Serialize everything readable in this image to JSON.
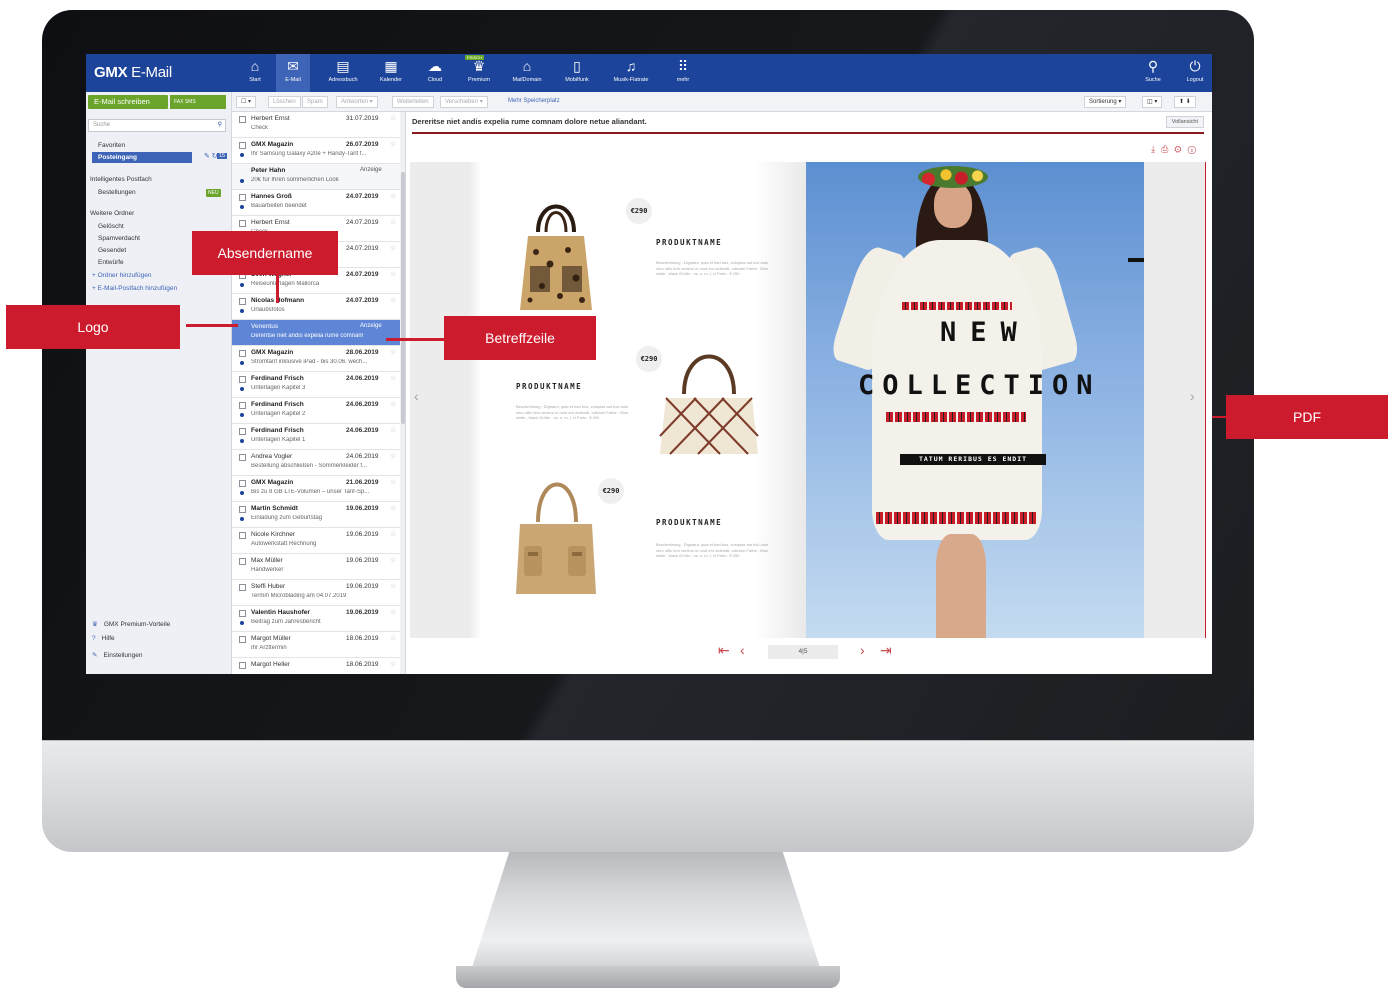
{
  "app": {
    "logo_bold": "GMX",
    "logo_rest": " E-Mail"
  },
  "nav": [
    {
      "label": "Start",
      "icon": "home-icon",
      "glyph": "⌂"
    },
    {
      "label": "E-Mail",
      "icon": "envelope-icon",
      "glyph": "✉"
    },
    {
      "label": "Adressbuch",
      "icon": "address-book-icon",
      "glyph": "▤"
    },
    {
      "label": "Kalender",
      "icon": "calendar-icon",
      "glyph": "▦"
    },
    {
      "label": "Cloud",
      "icon": "cloud-icon",
      "glyph": "☁"
    },
    {
      "label": "Premium",
      "icon": "premium-crown-icon",
      "glyph": "♛",
      "badge": "FRISCH"
    },
    {
      "label": "MailDomain",
      "icon": "domain-house-icon",
      "glyph": "⌂"
    },
    {
      "label": "Mobilfunk",
      "icon": "mobile-icon",
      "glyph": "▯"
    },
    {
      "label": "Musik-Flatrate",
      "icon": "music-icon",
      "glyph": "♫"
    },
    {
      "label": "mehr",
      "icon": "grid-icon",
      "glyph": "⠿"
    }
  ],
  "nav_right": [
    {
      "label": "Suche",
      "icon": "search-icon",
      "glyph": "⚲"
    },
    {
      "label": "Logout",
      "icon": "power-icon",
      "glyph": "⏻"
    }
  ],
  "sidebar": {
    "compose": "E-Mail schreiben",
    "fax_sms": "FAX SMS",
    "search_placeholder": "Suche",
    "favoriten": "Favoriten",
    "posteingang": "Posteingang",
    "posteingang_count": "15",
    "smart_box": "Intelligentes Postfach",
    "bestellungen": "Bestellungen",
    "neu_badge": "NEU",
    "weitere": "Weitere Ordner",
    "folders": [
      "Gelöscht",
      "Spamverdacht",
      "Gesendet",
      "Entwürfe"
    ],
    "add_folder": "Ordner hinzufügen",
    "add_mailbox": "E-Mail-Postfach hinzufügen",
    "bottom": [
      {
        "label": "GMX Premium-Vorteile",
        "icon": "crown-icon",
        "glyph": "♛"
      },
      {
        "label": "Hilfe",
        "icon": "help-icon",
        "glyph": "?"
      },
      {
        "label": "Einstellungen",
        "icon": "wrench-icon",
        "glyph": "✎"
      }
    ]
  },
  "toolbar": {
    "delete": "Löschen",
    "spam": "Spam",
    "reply": "Antworten",
    "forward": "Weiterleiten",
    "move": "Verschieben",
    "more_storage": "Mehr Speicherplatz",
    "sort": "Sortierung"
  },
  "messages": [
    {
      "sender": "Herbert Ernst",
      "date": "31.07.2019",
      "subject": "Check",
      "unread": false
    },
    {
      "sender": "GMX Magazin",
      "date": "26.07.2019",
      "subject": "Ihr Samsung Galaxy A20e + Handy-Tarif f...",
      "unread": true
    },
    {
      "sender": "Peter Hahn",
      "date": "Anzeige",
      "subject": "20€ für Ihren sommerlichen Look",
      "unread": true,
      "ad": true
    },
    {
      "sender": "Hannes Groß",
      "date": "24.07.2019",
      "subject": "Bauarbeiten beendet",
      "unread": true
    },
    {
      "sender": "Herbert Ernst",
      "date": "24.07.2019",
      "subject": "Check",
      "unread": false
    },
    {
      "sender": "Susanne Meyer",
      "date": "24.07.2019",
      "subject": "Urlaubsfotos",
      "unread": false
    },
    {
      "sender": "Sven Wagner",
      "date": "24.07.2019",
      "subject": "Reiseunterlagen Mallorca",
      "unread": true
    },
    {
      "sender": "Nicolas Hofmann",
      "date": "24.07.2019",
      "subject": "Urlaubsfotos",
      "unread": true
    },
    {
      "sender": "Venentus",
      "date": "Anzeige",
      "subject": "Dereritse niet andis expelia rume comnam",
      "unread": false,
      "ad": true,
      "selected": true
    },
    {
      "sender": "GMX Magazin",
      "date": "28.06.2019",
      "subject": "Stromtarif inklusive iPad - bis 30.06. wech...",
      "unread": true
    },
    {
      "sender": "Ferdinand Frisch",
      "date": "24.06.2019",
      "subject": "Unterlagen Kapitel 3",
      "unread": true
    },
    {
      "sender": "Ferdinand Frisch",
      "date": "24.06.2019",
      "subject": "Unterlagen Kapitel 2",
      "unread": true
    },
    {
      "sender": "Ferdinand Frisch",
      "date": "24.06.2019",
      "subject": "Unterlagen Kapitel 1",
      "unread": true
    },
    {
      "sender": "Andrea Vogler",
      "date": "24.06.2019",
      "subject": "Bestellung abschließen - Sommerkleider f...",
      "unread": false
    },
    {
      "sender": "GMX Magazin",
      "date": "21.06.2019",
      "subject": "Bis zu 8 GB LTE-Volumen – unser Tarif-Sp...",
      "unread": true
    },
    {
      "sender": "Martin Schmidt",
      "date": "19.06.2019",
      "subject": "Einladung zum Geburtstag",
      "unread": true
    },
    {
      "sender": "Nicole Kirchner",
      "date": "19.06.2019",
      "subject": "Autowerkstatt Rechnung",
      "unread": false
    },
    {
      "sender": "Max Müller",
      "date": "19.06.2019",
      "subject": "Handwerker",
      "unread": false
    },
    {
      "sender": "Steffi Huber",
      "date": "19.06.2019",
      "subject": "Termin Microblading am 04.07.2019",
      "unread": false
    },
    {
      "sender": "Valentin Haushofer",
      "date": "19.06.2019",
      "subject": "Beitrag zum Jahresbericht",
      "unread": true
    },
    {
      "sender": "Margot Müller",
      "date": "18.06.2019",
      "subject": "Ihr Arzttermin",
      "unread": false
    },
    {
      "sender": "Margot Heller",
      "date": "18.06.2019",
      "subject": "",
      "unread": false
    }
  ],
  "reading": {
    "subject": "Dereritse niet andis expelia rume comnam dolore netue aliandant.",
    "full_view": "Vollansicht"
  },
  "pdf": {
    "price": "€290",
    "product_name": "PRODUKTNAME",
    "product_desc": "Beschreibung : Dignatur, quia et hari bus, voluptas aut fuci aute vero offic tem venimo ut mod ero dolendit, odicium Farbe : Blue , white , black Größe : xs, s, m, l, xl Preis : € 290",
    "headline_1": "NEW",
    "headline_2": "COLLECTION",
    "tagline": "TATUM RERIBUS ES ENDIT",
    "page_indicator": "4|5"
  },
  "annotations": {
    "sender_name": "Absendername",
    "logo": "Logo",
    "subject_line": "Betreffzeile",
    "pdf": "PDF"
  },
  "colors": {
    "brand_blue": "#1c449b",
    "compose_green": "#6aa42b",
    "annotation_red": "#cd1b2e"
  }
}
